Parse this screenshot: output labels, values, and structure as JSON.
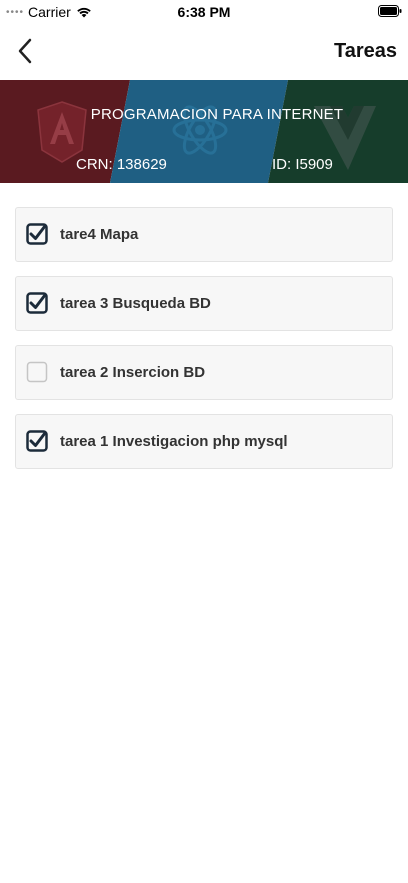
{
  "status_bar": {
    "carrier": "Carrier",
    "time": "6:38 PM",
    "icons": [
      "signal-dots",
      "wifi-icon",
      "battery-icon"
    ]
  },
  "nav": {
    "title": "Tareas",
    "back_icon": "chevron-left-icon"
  },
  "banner": {
    "title": "PROGRAMACION PARA INTERNET",
    "crn": "CRN: 138629",
    "id": "ID: I5909",
    "colors": [
      "#5a1a20",
      "#1f5f83",
      "#163d2b"
    ],
    "logos": [
      "angular-logo",
      "react-logo",
      "vue-logo"
    ]
  },
  "tasks": [
    {
      "label": "tare4 Mapa",
      "checked": true
    },
    {
      "label": "tarea 3 Busqueda BD",
      "checked": true
    },
    {
      "label": "tarea 2 Insercion BD",
      "checked": false
    },
    {
      "label": "tarea 1 Investigacion php mysql",
      "checked": true
    }
  ]
}
